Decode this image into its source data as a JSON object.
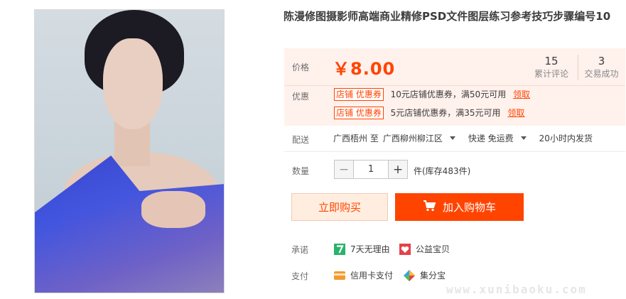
{
  "product": {
    "title": "陈漫修图摄影师高端商业精修PSD文件图层练习参考技巧步骤编号10"
  },
  "price": {
    "label": "价格",
    "value": "￥8.00",
    "accent_color": "#ff4400"
  },
  "stats": [
    {
      "num": "15",
      "label": "累计评论"
    },
    {
      "num": "3",
      "label": "交易成功"
    }
  ],
  "promotions": {
    "label": "优惠",
    "items": [
      {
        "tag": "店铺  优惠券",
        "desc": "10元店铺优惠券，满50元可用",
        "link": "领取"
      },
      {
        "tag": "店铺  优惠券",
        "desc": "5元店铺优惠券，满35元可用",
        "link": "领取"
      }
    ]
  },
  "delivery": {
    "label": "配送",
    "from": "广西梧州 至",
    "to": "广西柳州柳江区",
    "method": "快递 免运费",
    "time": "20小时内发货"
  },
  "quantity": {
    "label": "数量",
    "value": "1",
    "stock": "件(库存483件)",
    "minus": "−",
    "plus": "+"
  },
  "buttons": {
    "buy": "立即购买",
    "cart": "加入购物车"
  },
  "promise": {
    "label": "承诺",
    "items": [
      {
        "icon": "seven-day-return-icon",
        "text": "7天无理由"
      },
      {
        "icon": "charity-icon",
        "text": "公益宝贝"
      }
    ]
  },
  "payment": {
    "label": "支付",
    "items": [
      {
        "icon": "credit-card-icon",
        "text": "信用卡支付"
      },
      {
        "icon": "jifenbao-icon",
        "text": "集分宝"
      }
    ]
  },
  "watermark": "www.xunibaoku.com"
}
